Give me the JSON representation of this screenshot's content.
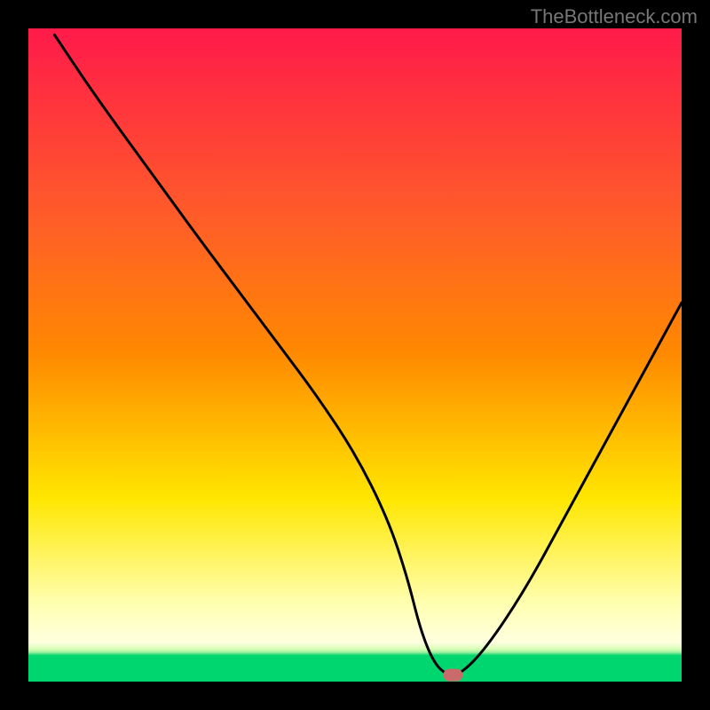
{
  "watermark": "TheBottleneck.com",
  "chart_data": {
    "type": "line",
    "title": "",
    "xlabel": "",
    "ylabel": "",
    "xlim": [
      0,
      100
    ],
    "ylim": [
      0,
      100
    ],
    "background_gradient": {
      "top": "#ff1a4a",
      "mid1": "#ff8a00",
      "mid2": "#ffe600",
      "mid3": "#ffffb0",
      "bottom_band": "#00d66f"
    },
    "series": [
      {
        "name": "bottleneck-curve",
        "color": "#000000",
        "x": [
          4,
          10,
          18,
          26,
          32,
          38,
          44,
          50,
          55,
          58,
          60,
          62,
          64,
          66,
          70,
          76,
          82,
          88,
          94,
          100
        ],
        "values": [
          99,
          90,
          79,
          68,
          60,
          52,
          44,
          35,
          25,
          16,
          8,
          3,
          1,
          1,
          5,
          14,
          25,
          36,
          47,
          58
        ]
      }
    ],
    "marker": {
      "name": "optimum-point",
      "x": 65,
      "y": 1,
      "color": "#c96b6b"
    },
    "frame_color": "#000000"
  }
}
